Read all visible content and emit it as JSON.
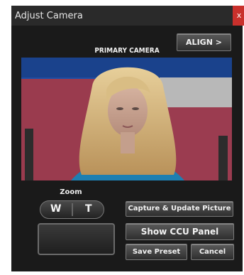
{
  "window": {
    "title": "Adjust Camera",
    "close_label": "x"
  },
  "toolbar": {
    "align_label": "ALIGN >"
  },
  "camera": {
    "label": "PRIMARY CAMERA"
  },
  "zoom": {
    "label": "Zoom",
    "wide": "W",
    "tele": "T"
  },
  "actions": {
    "capture_label": "Capture & Update Picture",
    "ccu_label": "Show CCU Panel",
    "save_preset_label": "Save Preset",
    "cancel_label": "Cancel"
  }
}
